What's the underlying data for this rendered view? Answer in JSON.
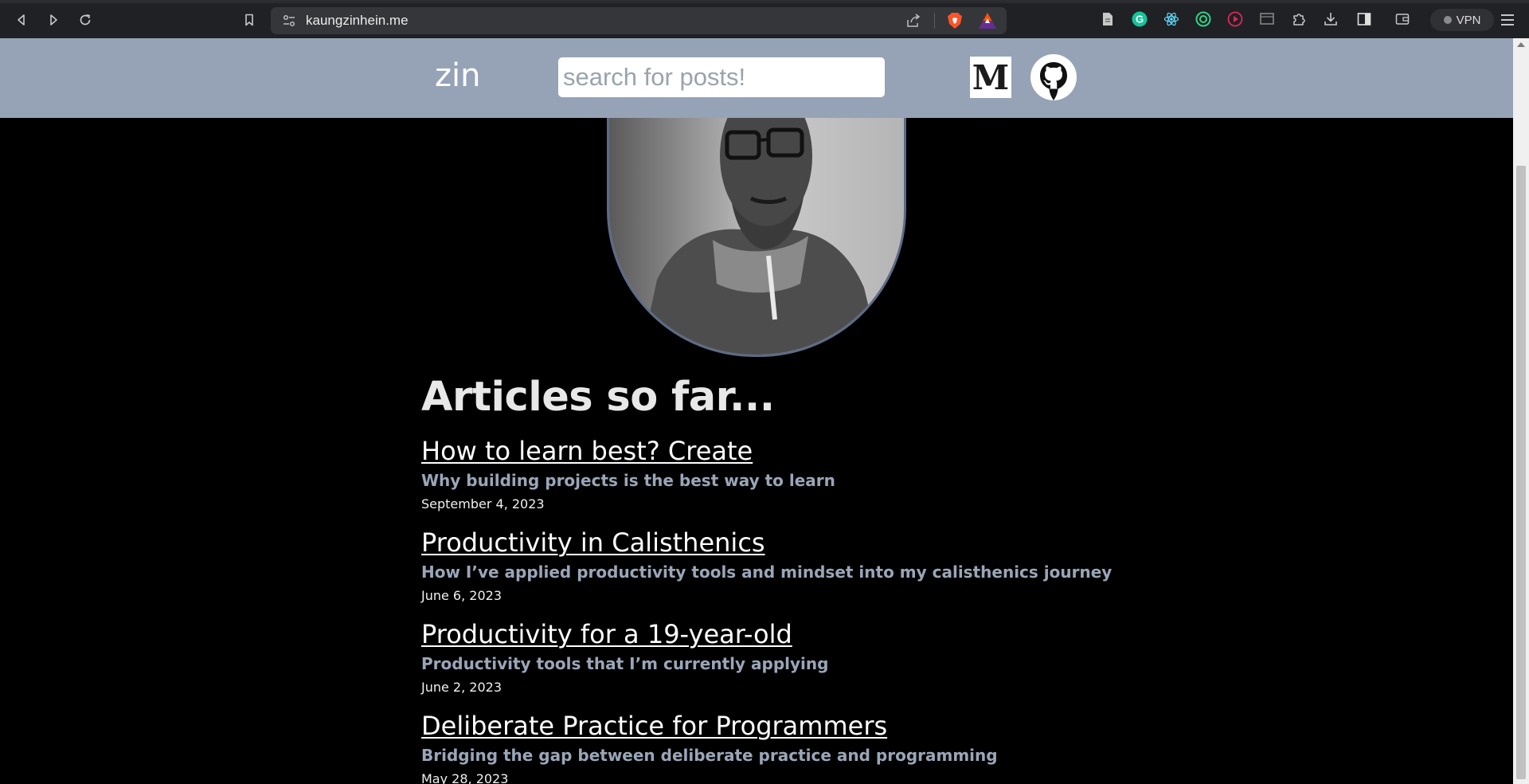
{
  "browser": {
    "url": "kaungzinhein.me",
    "vpn_label": "VPN",
    "icons": {
      "back": "back-icon",
      "forward": "forward-icon",
      "reload": "reload-icon",
      "bookmark": "bookmark-icon",
      "site_settings": "site-settings-icon",
      "share": "share-icon",
      "brave_shields": "brave-shields-icon",
      "brave_rewards": "brave-rewards-icon",
      "extensions": [
        "notes-icon",
        "grammarly-icon",
        "react-devtools-icon",
        "target-icon",
        "video-icon",
        "screen-icon",
        "puzzle-icon",
        "download-icon",
        "sidebar-icon",
        "wallet-icon"
      ],
      "menu": "menu-icon"
    },
    "colors": {
      "grammarly": "#15c39a",
      "react": "#61dafb",
      "target": "#2fd48a",
      "video": "#e0245e"
    }
  },
  "site": {
    "logo": "zin",
    "search_placeholder": "search for posts!",
    "medium_letter": "M",
    "header_color": "#96a3b6",
    "avatar_border": "#5c6b86"
  },
  "articles": {
    "heading": "Articles so far...",
    "posts": [
      {
        "title": "How to learn best? Create",
        "subtitle": "Why building projects is the best way to learn",
        "date": "September 4, 2023"
      },
      {
        "title": "Productivity in Calisthenics",
        "subtitle": "How I’ve applied productivity tools and mindset into my calisthenics journey",
        "date": "June 6, 2023"
      },
      {
        "title": "Productivity for a 19-year-old",
        "subtitle": "Productivity tools that I’m currently applying",
        "date": "June 2, 2023"
      },
      {
        "title": "Deliberate Practice for Programmers",
        "subtitle": "Bridging the gap between deliberate practice and programming",
        "date": "May 28, 2023"
      }
    ]
  }
}
